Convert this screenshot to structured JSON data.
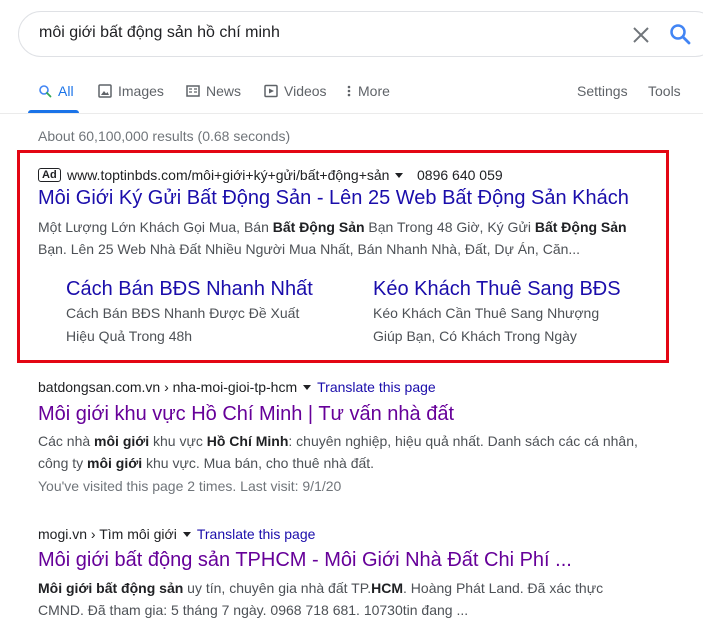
{
  "search": {
    "query": "môi giới bất động sản hồ chí minh"
  },
  "tabs": [
    {
      "label": "All",
      "icon": "search-icon"
    },
    {
      "label": "Images",
      "icon": "image-icon"
    },
    {
      "label": "News",
      "icon": "news-icon"
    },
    {
      "label": "Videos",
      "icon": "video-icon"
    },
    {
      "label": "More",
      "icon": "more-vert-icon"
    }
  ],
  "tools": {
    "settings_label": "Settings",
    "tools_label": "Tools"
  },
  "result_stats": "About 60,100,000 results (0.68 seconds)",
  "ad": {
    "badge": "Ad",
    "url": "www.toptinbds.com/môi+giới+ký+gửi/bất+động+sản",
    "phone": "0896 640 059",
    "title": "Môi Giới Ký Gửi Bất Động Sản - Lên 25 Web Bất Động Sản Khách",
    "desc_line1_parts": [
      "Một Lượng Lớn Khách Gọi Mua, Bán ",
      "Bất Động Sản",
      " Bạn Trong 48 Giờ, Ký Gửi ",
      "Bất Động Sản"
    ],
    "desc_line2": "Bạn. Lên 25 Web Nhà Đất Nhiều Người Mua Nhất, Bán Nhanh Nhà, Đất, Dự Án, Căn...",
    "sitelinks": [
      {
        "title": "Cách Bán BĐS Nhanh Nhất",
        "desc1": "Cách Bán BĐS Nhanh Được Đề Xuất",
        "desc2": "Hiệu Quả Trong 48h"
      },
      {
        "title": "Kéo Khách Thuê Sang BĐS",
        "desc1": "Kéo Khách Cần Thuê Sang Nhượng",
        "desc2": "Giúp Bạn, Có Khách Trong Ngày"
      }
    ]
  },
  "results": [
    {
      "cite": "batdongsan.com.vn › nha-moi-gioi-tp-hcm",
      "translate": "Translate this page",
      "title": "Môi giới khu vực Hồ Chí Minh | Tư vấn nhà đất",
      "line1_parts": [
        "Các nhà ",
        "môi giới",
        " khu vực ",
        "Hồ Chí Minh",
        ": chuyên nghiệp, hiệu quả nhất. Danh sách các cá nhân,"
      ],
      "line2_parts": [
        "công ty ",
        "môi giới",
        " khu vực. Mua bán, cho thuê nhà đất."
      ],
      "visited": "You've visited this page 2 times. Last visit: 9/1/20"
    },
    {
      "cite": "mogi.vn › Tìm môi giới",
      "translate": "Translate this page",
      "title": "Môi giới bất động sản TPHCM - Môi Giới Nhà Đất Chi Phí ...",
      "line1_parts": [
        "Môi giới bất động sản",
        " uy tín, chuyên gia nhà đất TP.",
        "HCM",
        ". Hoàng Phát Land. Đã xác thực"
      ],
      "line2": "CMND. Đã tham gia: 5 tháng 7 ngày. 0968 718 681. 10730tin đang ..."
    }
  ]
}
